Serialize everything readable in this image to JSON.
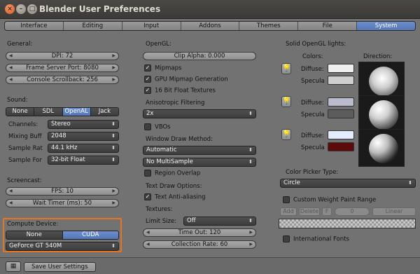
{
  "window": {
    "title": "Blender User Preferences",
    "close": "×",
    "minimize": "–",
    "maximize": "□"
  },
  "tabs": [
    "Interface",
    "Editing",
    "Input",
    "Addons",
    "Themes",
    "File",
    "System"
  ],
  "active_tab": "System",
  "general": {
    "heading": "General:",
    "dpi": "DPI: 72",
    "frame_server": "Frame Server Port: 8080",
    "console": "Console Scrollback: 256"
  },
  "sound": {
    "heading": "Sound:",
    "options": [
      "None",
      "SDL",
      "OpenAL",
      "Jack"
    ],
    "active": "OpenAL",
    "channels_label": "Channels:",
    "channels_value": "Stereo",
    "mixing_label": "Mixing Buff",
    "mixing_value": "2048",
    "rate_label": "Sample Rat",
    "rate_value": "44.1 kHz",
    "format_label": "Sample For",
    "format_value": "32-bit Float"
  },
  "screencast": {
    "heading": "Screencast:",
    "fps": "FPS: 10",
    "wait": "Wait Timer (ms): 50"
  },
  "compute": {
    "heading": "Compute Device:",
    "options": [
      "None",
      "CUDA"
    ],
    "active": "CUDA",
    "device": "GeForce GT 540M"
  },
  "opengl": {
    "heading": "OpenGL:",
    "clip_alpha": "Clip Alpha: 0.000",
    "mipmaps": "Mipmaps",
    "gpu_mipmap": "GPU Mipmap Generation",
    "float_textures": "16 Bit Float Textures",
    "aniso_label": "Anisotropic Filtering",
    "aniso_value": "2x",
    "vbos": "VBOs",
    "window_draw_label": "Window Draw Method:",
    "window_draw_value": "Automatic",
    "multisample_value": "No MultiSample",
    "region_overlap": "Region Overlap",
    "text_draw_label": "Text Draw Options:",
    "text_aa": "Text Anti-aliasing",
    "textures_label": "Textures:",
    "limit_label": "Limit Size:",
    "limit_value": "Off",
    "timeout": "Time Out: 120",
    "collection": "Collection Rate: 60"
  },
  "lights": {
    "heading": "Solid OpenGL lights:",
    "colors_label": "Colors:",
    "direction_label": "Direction:",
    "diffuse_label": "Diffuse:",
    "specular_label": "Specula",
    "light_colors": [
      {
        "diffuse": "#eeeeee",
        "specular": "#cfcfcf"
      },
      {
        "diffuse": "#b9bccd",
        "specular": "#5c5c5c"
      },
      {
        "diffuse": "#e6ecff",
        "specular": "#5c0a0a"
      }
    ]
  },
  "color_picker": {
    "label": "Color Picker Type:",
    "value": "Circle"
  },
  "weight_paint": {
    "label": "Custom Weight Paint Range",
    "add": "Add",
    "delete": "Delete",
    "f": "F",
    "index": "0",
    "interp": "Linear"
  },
  "international": "International Fonts",
  "footer": {
    "save": "Save User Settings"
  },
  "colors": {
    "accent": "#5f82c4",
    "highlight": "#e8741e"
  }
}
